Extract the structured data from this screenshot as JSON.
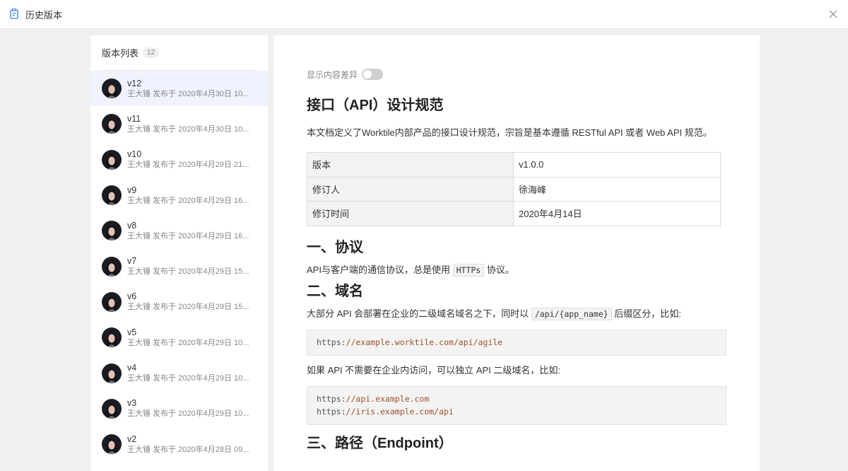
{
  "window": {
    "title": "历史版本"
  },
  "sidebar": {
    "title": "版本列表",
    "count": "12",
    "items": [
      {
        "name": "v12",
        "sub": "王大锤 发布于 2020年4月30日 10..."
      },
      {
        "name": "v11",
        "sub": "王大锤 发布于 2020年4月30日 10..."
      },
      {
        "name": "v10",
        "sub": "王大锤 发布于 2020年4月29日 21..."
      },
      {
        "name": "v9",
        "sub": "王大锤 发布于 2020年4月29日 16..."
      },
      {
        "name": "v8",
        "sub": "王大锤 发布于 2020年4月29日 16..."
      },
      {
        "name": "v7",
        "sub": "王大锤 发布于 2020年4月29日 15..."
      },
      {
        "name": "v6",
        "sub": "王大锤 发布于 2020年4月29日 15..."
      },
      {
        "name": "v5",
        "sub": "王大锤 发布于 2020年4月29日 10..."
      },
      {
        "name": "v4",
        "sub": "王大锤 发布于 2020年4月29日 10..."
      },
      {
        "name": "v3",
        "sub": "王大锤 发布于 2020年4月29日 10..."
      },
      {
        "name": "v2",
        "sub": "王大锤 发布于 2020年4月28日 09..."
      }
    ]
  },
  "doc": {
    "diff_label": "显示内容差异",
    "diff_enabled": false,
    "title": "接口（API）设计规范",
    "intro": "本文档定义了Worktile内部产品的接口设计规范，宗旨是基本遵循 RESTful API 或者 Web API 规范。",
    "table": [
      {
        "key": "版本",
        "value": "v1.0.0"
      },
      {
        "key": "修订人",
        "value": "徐海峰"
      },
      {
        "key": "修订时间",
        "value": "2020年4月14日"
      }
    ],
    "sec1_title": "一、协议",
    "sec1_before": "API与客户端的通信协议，总是使用",
    "sec1_code": "HTTPs",
    "sec1_after": "协议。",
    "sec2_title": "二、域名",
    "sec2_before": "大部分 API 会部署在企业的二级域名域名之下，同时以",
    "sec2_code": "/api/{app_name}",
    "sec2_after": "后缀区分，比如:",
    "code1": [
      {
        "scheme": "https:",
        "rest": "//example.worktile.com/api/agile"
      }
    ],
    "sec2_p2": "如果 API 不需要在企业内访问，可以独立 API 二级域名，比如:",
    "code2": [
      {
        "scheme": "https:",
        "rest": "//api.example.com"
      },
      {
        "scheme": "https:",
        "rest": "//iris.example.com/api"
      }
    ],
    "sec3_title": "三、路径（Endpoint）"
  },
  "colors": {
    "active_item_bg": "#eef3fd",
    "accent": "#3d7ae3",
    "code_string": "#a0522d"
  },
  "icons": {
    "title": "document-history-icon",
    "close": "close-icon",
    "avatar": "user-avatar"
  }
}
